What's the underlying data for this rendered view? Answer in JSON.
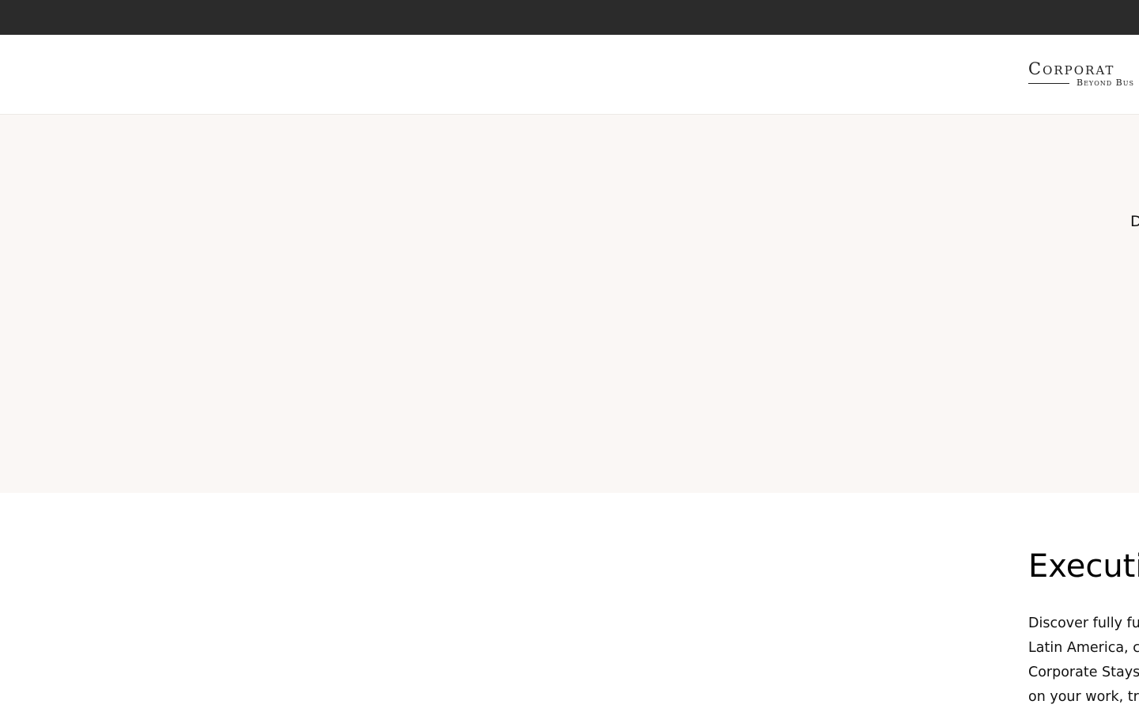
{
  "header": {
    "logo_main": "Corporat",
    "logo_sub": "Beyond Bus"
  },
  "hero": {
    "partial_text": "D"
  },
  "main": {
    "title": "Executi",
    "lines": [
      "Discover fully fu",
      "Latin America, c",
      "Corporate Stays",
      "on your work, tr"
    ]
  }
}
